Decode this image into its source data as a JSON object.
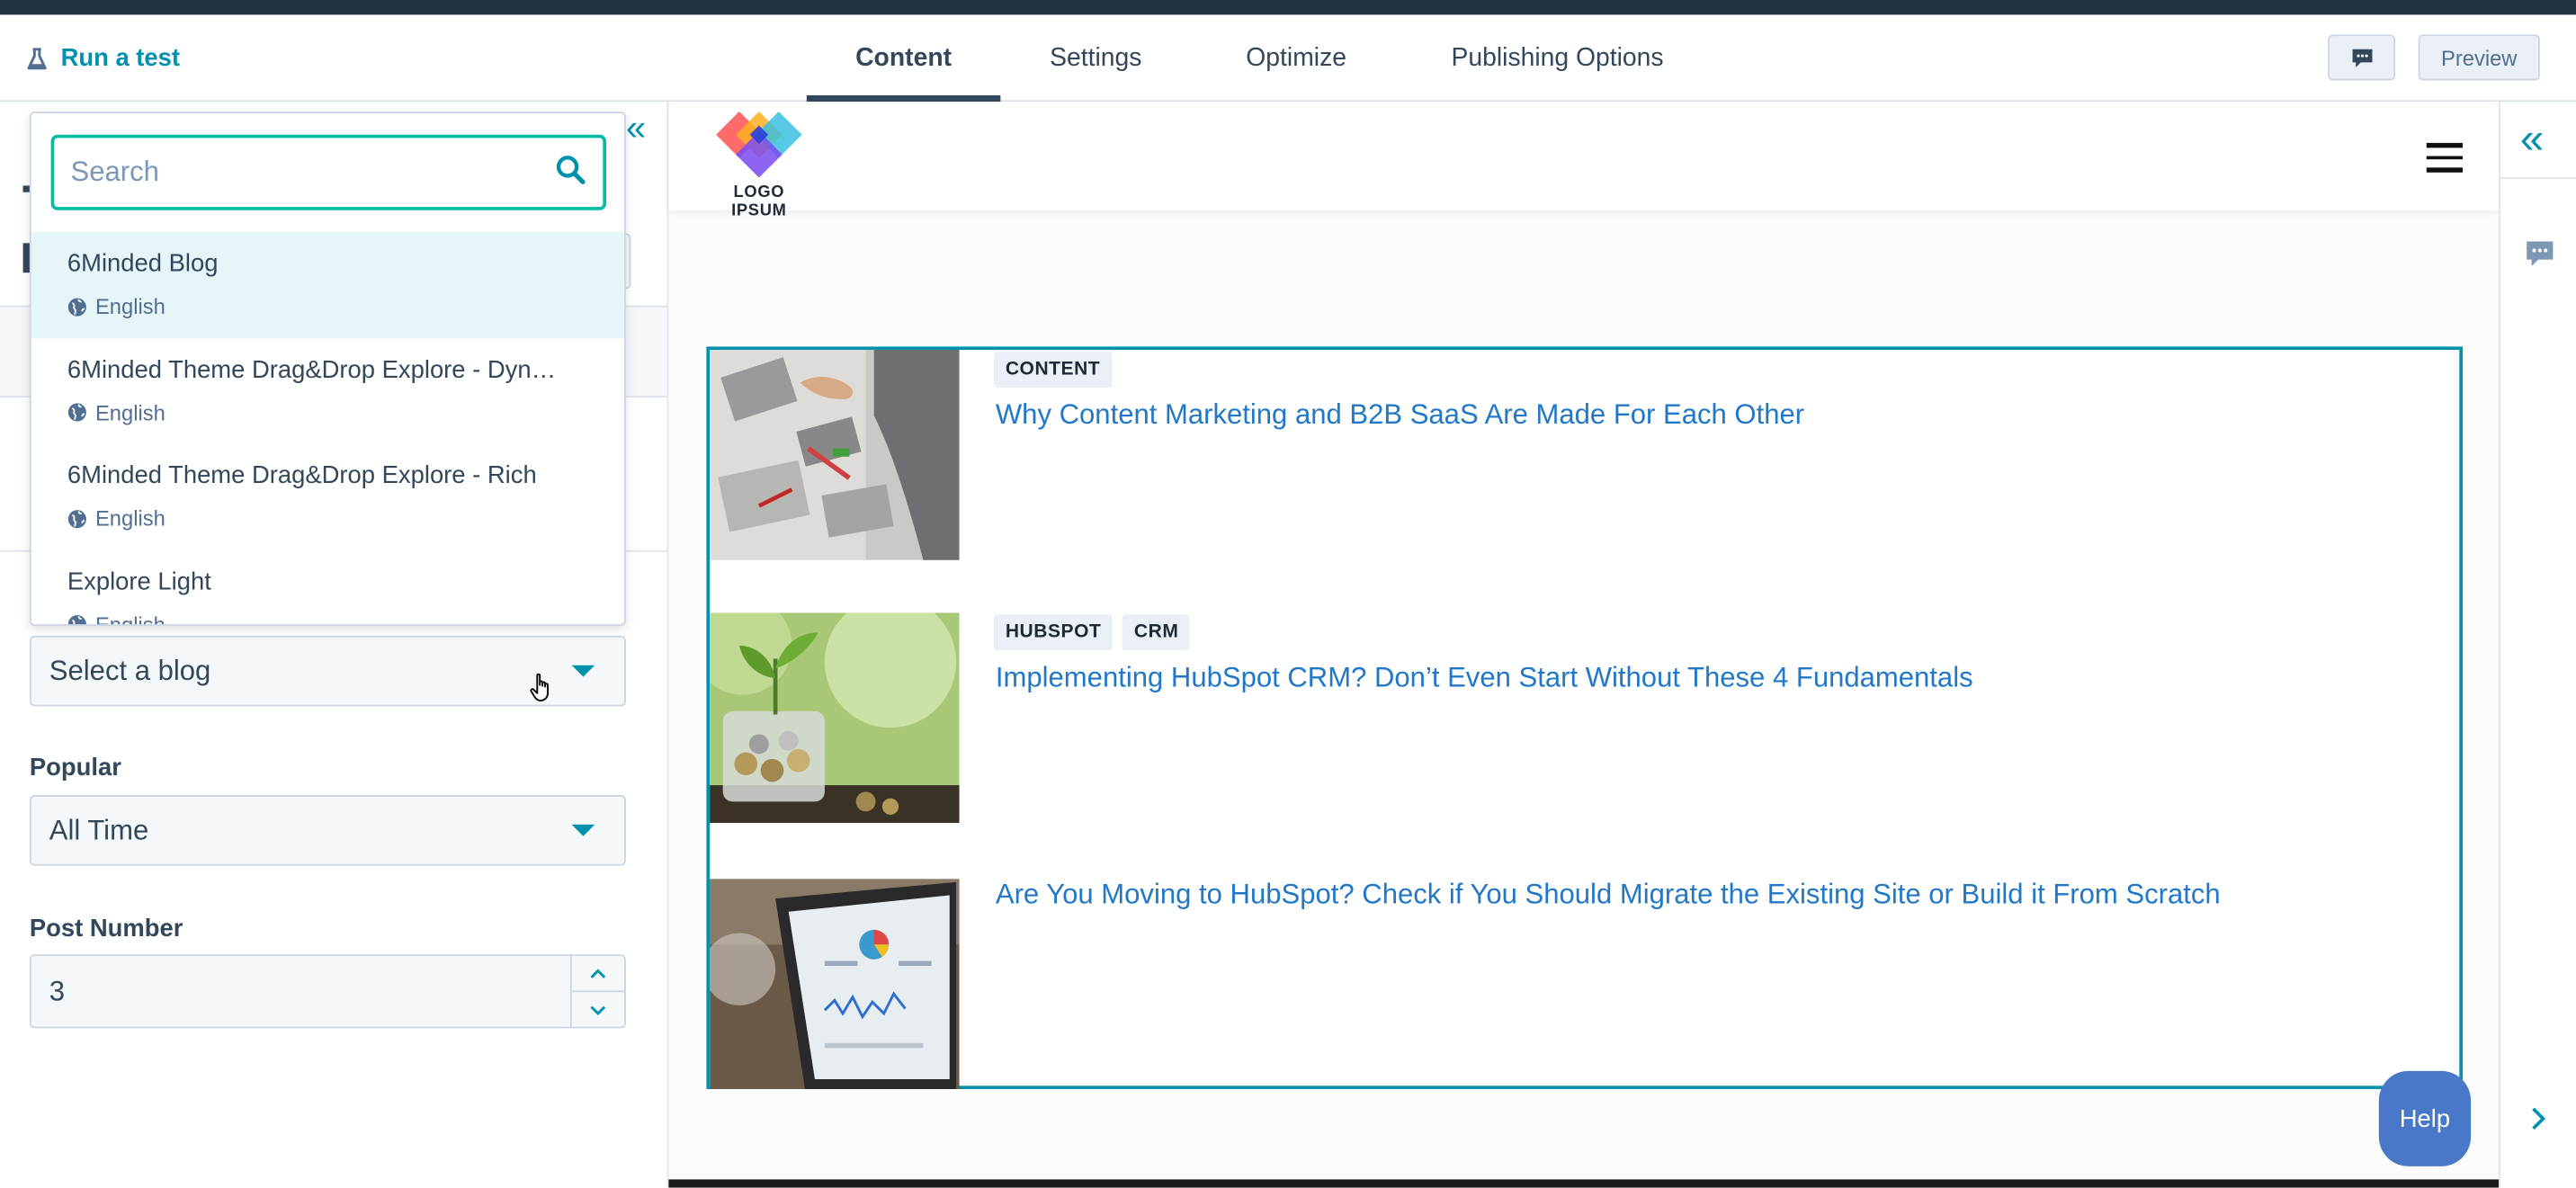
{
  "toolbar": {
    "run_test": "Run a test",
    "tabs": [
      {
        "label": "Content"
      },
      {
        "label": "Settings"
      },
      {
        "label": "Optimize"
      },
      {
        "label": "Publishing Options"
      }
    ],
    "preview_label": "Preview"
  },
  "dropdown": {
    "search_placeholder": "Search",
    "items": [
      {
        "name": "6Minded Blog",
        "lang": "English"
      },
      {
        "name": "6Minded Theme Drag&Drop Explore - Dyn…",
        "lang": "English"
      },
      {
        "name": "6Minded Theme Drag&Drop Explore - Rich",
        "lang": "English"
      },
      {
        "name": "Explore Light",
        "lang": "English"
      }
    ]
  },
  "fields": {
    "blog_select": {
      "value": "Select a blog"
    },
    "popular": {
      "label": "Popular",
      "value": "All Time"
    },
    "post_number": {
      "label": "Post Number",
      "value": "3"
    }
  },
  "preview": {
    "logo_text": "LOGO IPSUM",
    "posts": [
      {
        "tags": [
          "CONTENT"
        ],
        "title": "Why Content Marketing and B2B SaaS Are Made For Each Other"
      },
      {
        "tags": [
          "HUBSPOT",
          "CRM"
        ],
        "title": "Implementing HubSpot CRM? Don’t Even Start Without These 4 Fundamentals"
      },
      {
        "tags": [],
        "title": "Are You Moving to HubSpot? Check if You Should Migrate the Existing Site or Build it From Scratch"
      }
    ],
    "help_label": "Help"
  },
  "colors": {
    "accent": "#0091ae",
    "selection_green": "#00bda5",
    "link_blue": "#2278c8",
    "text_dark": "#33475b",
    "help_blue": "#4a78c8"
  }
}
